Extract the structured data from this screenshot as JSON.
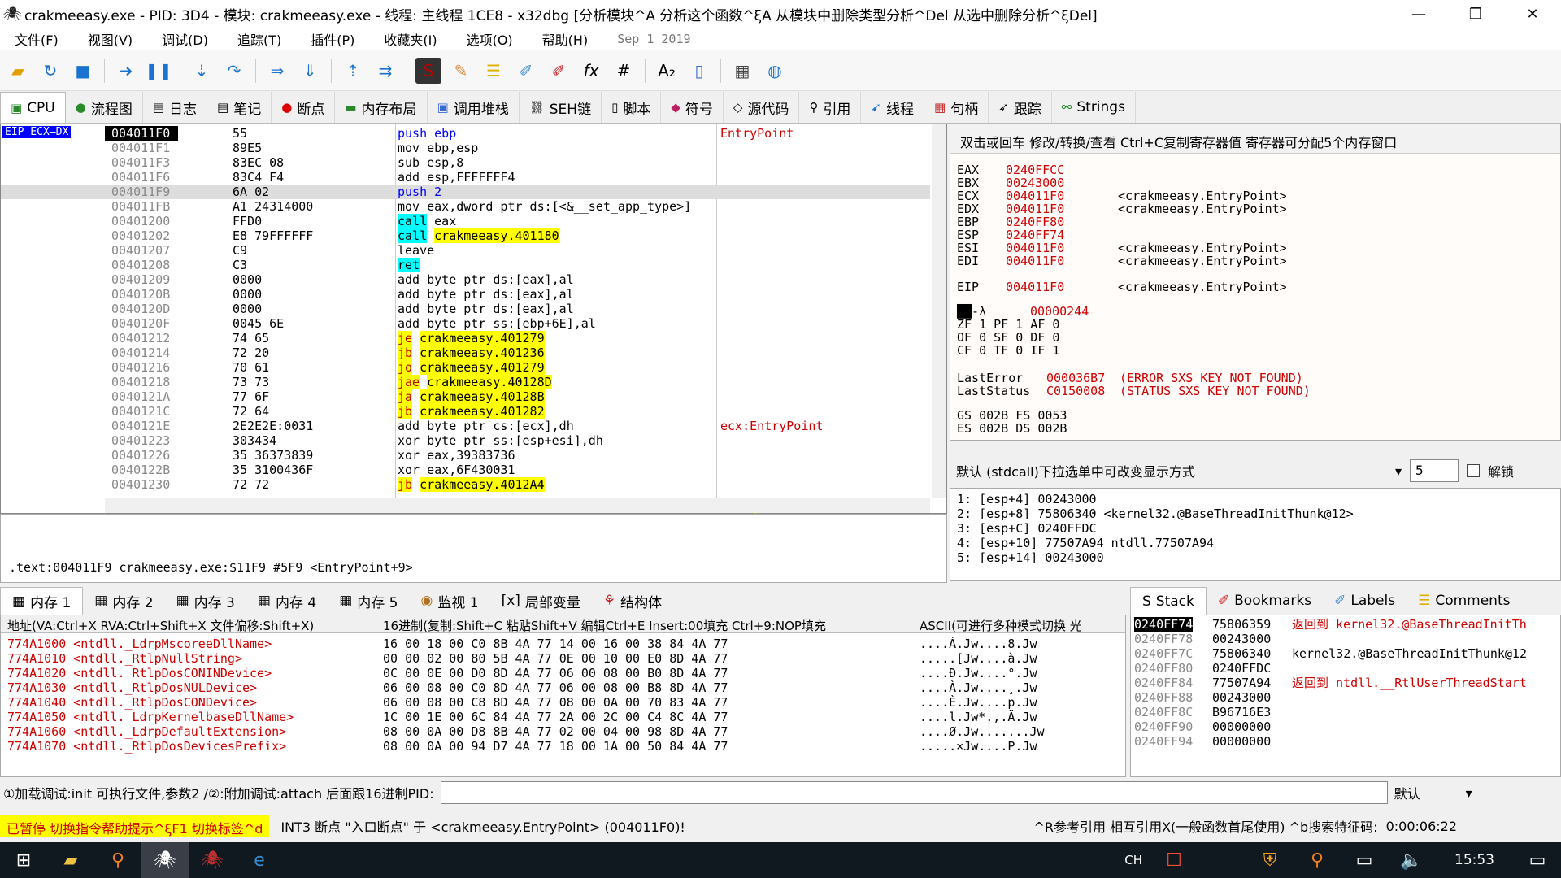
{
  "window": {
    "title": "crakmeeasy.exe - PID: 3D4 - 模块: crakmeeasy.exe - 线程: 主线程 1CE8 - x32dbg [分析模块^A  分析这个函数^ξA  从模块中删除类型分析^Del  从选中删除分析^ξDel]",
    "minimize": "—",
    "maximize": "❐",
    "close": "✕"
  },
  "menu": {
    "items": [
      "文件(F)",
      "视图(V)",
      "调试(D)",
      "追踪(T)",
      "插件(P)",
      "收藏夹(I)",
      "选项(O)",
      "帮助(H)"
    ],
    "date": "Sep 1 2019"
  },
  "toolbar": {
    "icons": [
      "folder-icon",
      "restart-icon",
      "stop-icon",
      "run-icon",
      "pause-icon",
      "step-into-icon",
      "step-over-icon",
      "trace-into-icon",
      "trace-over-icon",
      "execute-till-return-icon",
      "run-to-user-icon",
      "script-icon",
      "patch-icon",
      "comments-icon",
      "labels-icon",
      "bookmarks-icon",
      "function-icon",
      "hash-icon",
      "font-icon",
      "device-icon",
      "calculator-icon",
      "globe-icon"
    ],
    "fx": "fx",
    "hash": "#",
    "az": "A₂"
  },
  "tabs": [
    "CPU",
    "流程图",
    "日志",
    "笔记",
    "断点",
    "内存布局",
    "调用堆栈",
    "SEH链",
    "脚本",
    "符号",
    "源代码",
    "引用",
    "线程",
    "句柄",
    "跟踪",
    "Strings"
  ],
  "eip_label": "EIP ECX—DX",
  "disasm": [
    {
      "addr": "004011F0",
      "bytes": "55",
      "instr": "push ebp",
      "cmt": "EntryPoint",
      "cur": true
    },
    {
      "addr": "004011F1",
      "bytes": "89E5",
      "instr": "mov ebp,esp",
      "cmt": ""
    },
    {
      "addr": "004011F3",
      "bytes": "83EC 08",
      "instr": "sub esp,8",
      "cmt": ""
    },
    {
      "addr": "004011F6",
      "bytes": "83C4 F4",
      "instr": "add esp,FFFFFFF4",
      "cmt": ""
    },
    {
      "addr": "004011F9",
      "bytes": "6A 02",
      "instr": "push 2",
      "cmt": "",
      "hl": true
    },
    {
      "addr": "004011FB",
      "bytes": "A1 24314000",
      "instr": "mov eax,dword ptr ds:[<&__set_app_type>]",
      "cmt": ""
    },
    {
      "addr": "00401200",
      "bytes": "FFD0",
      "instr": "call eax",
      "cmt": ""
    },
    {
      "addr": "00401202",
      "bytes": "E8 79FFFFFF",
      "instr": "call crakmeeasy.401180",
      "cmt": ""
    },
    {
      "addr": "00401207",
      "bytes": "C9",
      "instr": "leave",
      "cmt": ""
    },
    {
      "addr": "00401208",
      "bytes": "C3",
      "instr": "ret",
      "cmt": ""
    },
    {
      "addr": "00401209",
      "bytes": "0000",
      "instr": "add byte ptr ds:[eax],al",
      "cmt": ""
    },
    {
      "addr": "0040120B",
      "bytes": "0000",
      "instr": "add byte ptr ds:[eax],al",
      "cmt": ""
    },
    {
      "addr": "0040120D",
      "bytes": "0000",
      "instr": "add byte ptr ds:[eax],al",
      "cmt": ""
    },
    {
      "addr": "0040120F",
      "bytes": "0045 6E",
      "instr": "add byte ptr ss:[ebp+6E],al",
      "cmt": ""
    },
    {
      "addr": "00401212",
      "bytes": "74 65",
      "instr": "je crakmeeasy.401279",
      "cmt": ""
    },
    {
      "addr": "00401214",
      "bytes": "72 20",
      "instr": "jb crakmeeasy.401236",
      "cmt": ""
    },
    {
      "addr": "00401216",
      "bytes": "70 61",
      "instr": "jo crakmeeasy.401279",
      "cmt": ""
    },
    {
      "addr": "00401218",
      "bytes": "73 73",
      "instr": "jae crakmeeasy.40128D",
      "cmt": ""
    },
    {
      "addr": "0040121A",
      "bytes": "77 6F",
      "instr": "ja crakmeeasy.40128B",
      "cmt": ""
    },
    {
      "addr": "0040121C",
      "bytes": "72 64",
      "instr": "jb crakmeeasy.401282",
      "cmt": ""
    },
    {
      "addr": "0040121E",
      "bytes": "2E2E2E:0031",
      "instr": "add byte ptr cs:[ecx],dh",
      "cmt": "ecx:EntryPoint"
    },
    {
      "addr": "00401223",
      "bytes": "303434",
      "instr": "xor byte ptr ss:[esp+esi],dh",
      "cmt": ""
    },
    {
      "addr": "00401226",
      "bytes": "35 36373839",
      "instr": "xor eax,39383736",
      "cmt": ""
    },
    {
      "addr": "0040122B",
      "bytes": "35 3100436F",
      "instr": "xor eax,6F430031",
      "cmt": ""
    },
    {
      "addr": "00401230",
      "bytes": "72 72",
      "instr": "jb crakmeeasy.4012A4",
      "cmt": ""
    }
  ],
  "info_text": ".text:004011F9 crakmeeasy.exe:$11F9 #5F9 <EntryPoint+9>",
  "regs_header": "双击或回车 修改/转换/查看  Ctrl+C复制寄存器值  寄存器可分配5个内存窗口",
  "registers": [
    {
      "n": "EAX",
      "v": "0240FFCC",
      "c": ""
    },
    {
      "n": "EBX",
      "v": "00243000",
      "c": ""
    },
    {
      "n": "ECX",
      "v": "004011F0",
      "c": "<crakmeeasy.EntryPoint>"
    },
    {
      "n": "EDX",
      "v": "004011F0",
      "c": "<crakmeeasy.EntryPoint>"
    },
    {
      "n": "EBP",
      "v": "0240FF80",
      "c": ""
    },
    {
      "n": "ESP",
      "v": "0240FF74",
      "c": ""
    },
    {
      "n": "ESI",
      "v": "004011F0",
      "c": "<crakmeeasy.EntryPoint>"
    },
    {
      "n": "EDI",
      "v": "004011F0",
      "c": "<crakmeeasy.EntryPoint>"
    },
    {
      "n": "EIP",
      "v": "004011F0",
      "c": "<crakmeeasy.EntryPoint>"
    }
  ],
  "eflags": {
    "label": "██-λ",
    "value": "00000244"
  },
  "flags": [
    "ZF 1  PF 1  AF 0",
    "OF 0  SF 0  DF 0",
    "CF 0  TF 0  IF 1"
  ],
  "last_error": {
    "label": "LastError",
    "v": "000036B7",
    "c": "(ERROR_SXS_KEY_NOT_FOUND)"
  },
  "last_status": {
    "label": "LastStatus",
    "v": "C0150008",
    "c": "(STATUS_SXS_KEY_NOT_FOUND)"
  },
  "segs": [
    "GS 002B  FS 0053",
    "ES 002B  DS 002B"
  ],
  "callconv": {
    "label": "默认 (stdcall)下拉选单中可改变显示方式",
    "count": "5",
    "lock": "解锁"
  },
  "args": [
    "1: [esp+4] 00243000",
    "2: [esp+8] 75806340 <kernel32.@BaseThreadInitThunk@12>",
    "3: [esp+C] 0240FFDC",
    "4: [esp+10] 77507A94 ntdll.77507A94",
    "5: [esp+14] 00243000"
  ],
  "dump_tabs": [
    "内存 1",
    "内存 2",
    "内存 3",
    "内存 4",
    "内存 5",
    "监视 1",
    "局部变量",
    "结构体"
  ],
  "stack_tabs": [
    "Stack",
    "Bookmarks",
    "Labels",
    "Comments"
  ],
  "dump_headers": {
    "addr": "地址(VA:Ctrl+X RVA:Ctrl+Shift+X 文件偏移:Shift+X)",
    "hex": "16进制(复制:Shift+C 粘贴Shift+V 编辑Ctrl+E Insert:00填充 Ctrl+9:NOP填充",
    "ascii": "ASCII(可进行多种模式切换 光"
  },
  "dump": [
    {
      "a": "774A1000 <ntdll._LdrpMscoreeDllName>",
      "h": "16 00 18 00  C0 8B 4A 77  14 00 16 00  38 84 4A 77",
      "s": "....À.Jw....8.Jw"
    },
    {
      "a": "774A1010 <ntdll._RtlpNullString>",
      "h": "00 00 02 00  80 5B 4A 77  0E 00 10 00  E0 8D 4A 77",
      "s": ".....[Jw....à.Jw"
    },
    {
      "a": "774A1020 <ntdll._RtlpDosCONINDevice>",
      "h": "0C 00 0E 00  D0 8D 4A 77  06 00 08 00  B0 8D 4A 77",
      "s": "....Ð.Jw....°.Jw"
    },
    {
      "a": "774A1030 <ntdll._RtlpDosNULDevice>",
      "h": "06 00 08 00  C0 8D 4A 77  06 00 08 00  B8 8D 4A 77",
      "s": "....À.Jw....¸.Jw"
    },
    {
      "a": "774A1040 <ntdll._RtlpDosCONDevice>",
      "h": "06 00 08 00  C8 8D 4A 77  08 00 0A 00  70 83 4A 77",
      "s": "....È.Jw....p.Jw"
    },
    {
      "a": "774A1050 <ntdll._LdrpKernelbaseDllName>",
      "h": "1C 00 1E 00  6C 84 4A 77  2A 00 2C 00  C4 8C 4A 77",
      "s": "....l.Jw*.,.Ä.Jw"
    },
    {
      "a": "774A1060 <ntdll._LdrpDefaultExtension>",
      "h": "08 00 0A 00  D8 8B 4A 77  02 00 04 00  98 8D 4A 77",
      "s": "....Ø.Jw.......Jw"
    },
    {
      "a": "774A1070 <ntdll._RtlpDosDevicesPrefix>",
      "h": "08 00 0A 00  94 D7 4A 77  18 00 1A 00  50 84 4A 77",
      "s": ".....×Jw....P.Jw"
    }
  ],
  "stack": [
    {
      "a": "0240FF74",
      "v": "75806359",
      "c": "返回到 kernel32.@BaseThreadInitTh",
      "cur": true
    },
    {
      "a": "0240FF78",
      "v": "00243000",
      "c": ""
    },
    {
      "a": "0240FF7C",
      "v": "75806340",
      "c": "kernel32.@BaseThreadInitThunk@12"
    },
    {
      "a": "0240FF80",
      "v": "0240FFDC",
      "c": ""
    },
    {
      "a": "0240FF84",
      "v": "77507A94",
      "c": "返回到 ntdll.__RtlUserThreadStart"
    },
    {
      "a": "0240FF88",
      "v": "00243000",
      "c": ""
    },
    {
      "a": "0240FF8C",
      "v": "B96716E3",
      "c": ""
    },
    {
      "a": "0240FF90",
      "v": "00000000",
      "c": ""
    },
    {
      "a": "0240FF94",
      "v": "00000000",
      "c": ""
    }
  ],
  "cmdbar": {
    "hint": "①加载调试:init 可执行文件,参数2 /②:附加调试:attach 后面跟16进制PID:",
    "mode": "默认"
  },
  "status": {
    "paused": "已暂停 切换指令帮助提示^ξF1 切换标签^d",
    "message": "INT3 断点 \"入口断点\" 于 <crakmeeasy.EntryPoint> (004011F0)!",
    "refs": "^R参考引用  相互引用X(一般函数首尾使用) ^b搜索特征码:",
    "time": "0:00:06:22"
  },
  "taskbar": {
    "ime": "CH",
    "clock": "15:53"
  }
}
